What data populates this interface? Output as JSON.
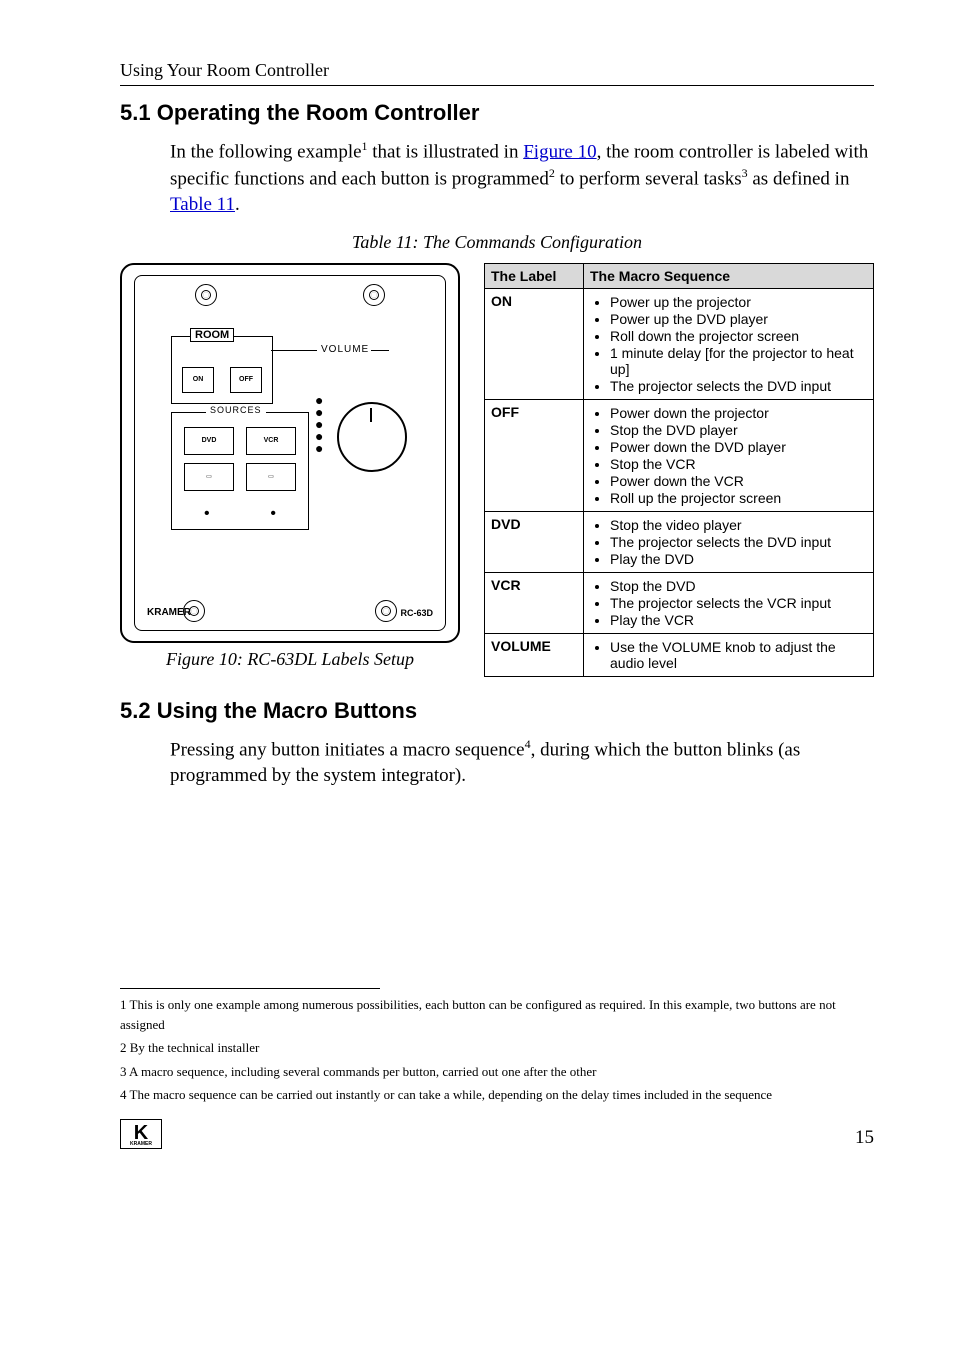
{
  "running_head": "Using Your Room Controller",
  "s51": {
    "number": "5.1",
    "title": "Operating the Room Controller",
    "para_parts": {
      "p1": "In the following example",
      "sup1": "1",
      "p2": " that is illustrated in ",
      "link1": "Figure 10",
      "p3": ", the room controller is labeled with specific functions and each button is programmed",
      "sup2": "2",
      "p4": " to perform several tasks",
      "sup3": "3",
      "p5": " as defined in ",
      "link2": "Table 11",
      "p6": "."
    }
  },
  "table_caption": "Table 11: The Commands Configuration",
  "figure_caption": "Figure 10: RC-63DL Labels Setup",
  "device": {
    "room": "ROOM",
    "on": "ON",
    "off": "OFF",
    "volume": "VOLUME",
    "sources": "SOURCES",
    "dvd": "DVD",
    "vcr": "VCR",
    "brand": "KRAMER",
    "model": "RC-63D"
  },
  "table": {
    "h1": "The Label",
    "h2": "The Macro Sequence",
    "rows": [
      {
        "label": "ON",
        "items": [
          "Power up the projector",
          "Power up the DVD player",
          "Roll down the projector screen",
          "1 minute delay [for the projector to heat up]",
          "The projector selects the DVD input"
        ]
      },
      {
        "label": "OFF",
        "items": [
          "Power down the projector",
          "Stop the DVD player",
          "Power down the DVD player",
          "Stop the VCR",
          "Power down the VCR",
          "Roll up the projector screen"
        ]
      },
      {
        "label": "DVD",
        "items": [
          "Stop the video player",
          "The projector selects the DVD input",
          "Play the DVD"
        ]
      },
      {
        "label": "VCR",
        "items": [
          "Stop the DVD",
          "The projector selects the VCR input",
          "Play the VCR"
        ]
      },
      {
        "label": "VOLUME",
        "items": [
          "Use the VOLUME knob to adjust the audio level"
        ]
      }
    ]
  },
  "s52": {
    "number": "5.2",
    "title": "Using the Macro Buttons",
    "para_parts": {
      "p1": "Pressing any button initiates a macro sequence",
      "sup": "4",
      "p2": ", during which the button blinks (as programmed by the system integrator)."
    }
  },
  "footnotes": {
    "f1": "1 This is only one example among numerous possibilities, each button can be configured as required. In this example, two buttons are not assigned",
    "f2": "2 By the technical installer",
    "f3": "3 A macro sequence, including several commands per button, carried out one after the other",
    "f4": "4 The macro sequence can be carried out instantly or can take a while, depending on the delay times included in the sequence"
  },
  "logo_letter": "K",
  "logo_sub": "KRAMER",
  "page_number": "15"
}
